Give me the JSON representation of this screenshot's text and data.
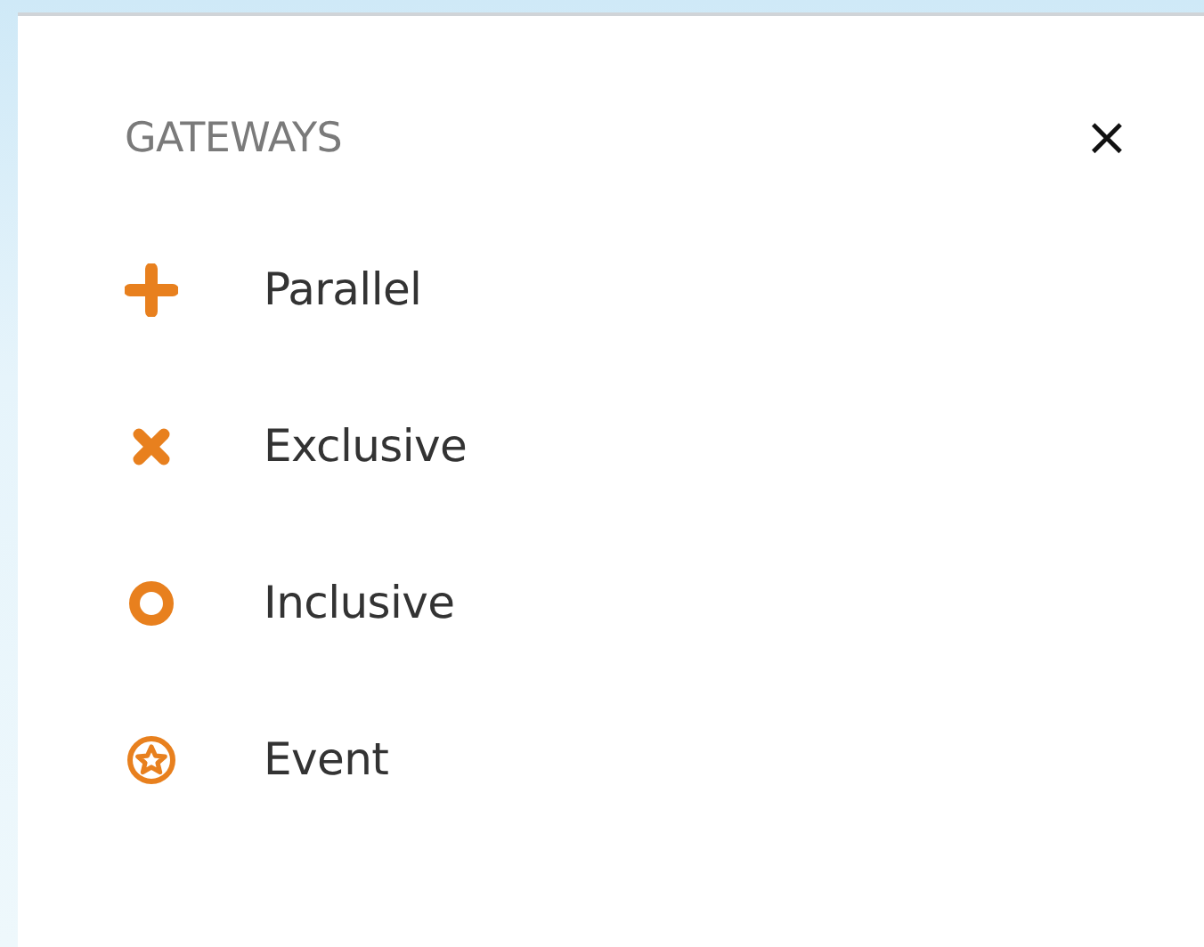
{
  "panel": {
    "title": "GATEWAYS",
    "close": "×"
  },
  "items": [
    {
      "label": "Parallel",
      "kind": "plus"
    },
    {
      "label": "Exclusive",
      "kind": "cross"
    },
    {
      "label": "Inclusive",
      "kind": "ring"
    },
    {
      "label": "Event",
      "kind": "star"
    }
  ]
}
